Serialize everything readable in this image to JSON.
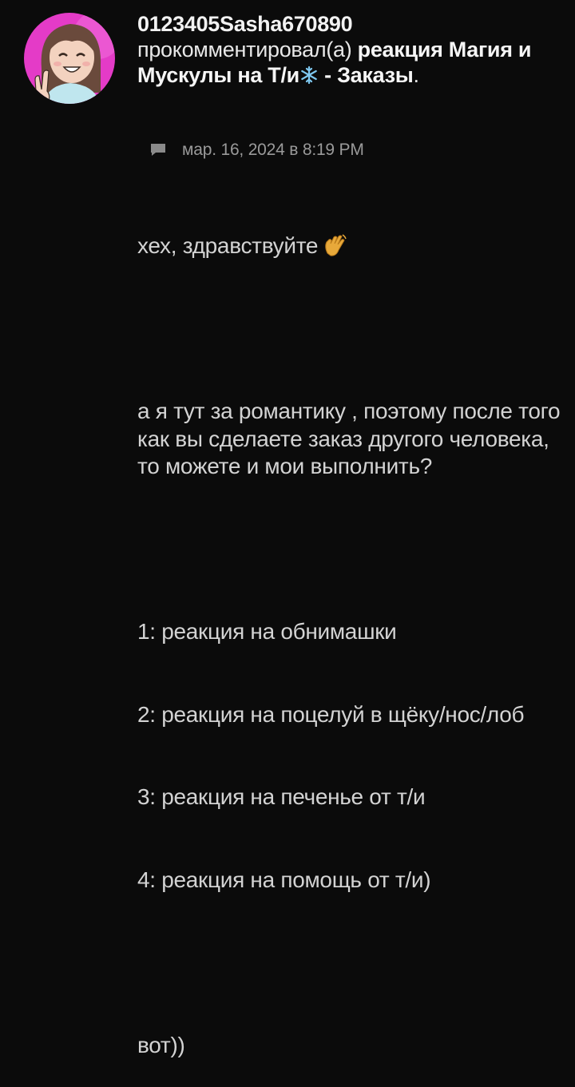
{
  "comment": {
    "username": "0123405Sasha670890",
    "action_text": "прокомментировал(а)",
    "post_title_part1": "реакция Магия и Мускулы на Т/и",
    "post_title_emoji": "snowflake-icon",
    "post_title_part2": " - Заказы",
    "post_title_end": ".",
    "timestamp": "мар. 16, 2024 в 8:19 PM",
    "greeting": "хех, здравствуйте",
    "greeting_emoji": "waving-hand-icon",
    "paragraph": "а я тут за романтику , поэтому после того как вы сделаете заказ другого человека, то можете и мои выполнить?",
    "list": [
      "1: реакция на обнимашки",
      "2: реакция на поцелуй в щёку/нос/лоб",
      "3: реакция на печенье от т/и",
      "4: реакция на помощь от т/и)"
    ],
    "closing": "вот))"
  },
  "colors": {
    "background": "#0b0b0b",
    "text": "#d3d3d3",
    "muted": "#9a9a9a",
    "avatar_bg": "#e43bc7"
  }
}
